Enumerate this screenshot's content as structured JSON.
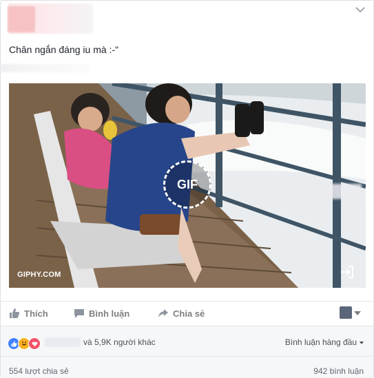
{
  "post": {
    "text": "Chân ngắn đáng iu mà :-\""
  },
  "media": {
    "gif_label": "GIF",
    "source_label": "GIPHY.COM"
  },
  "actions": {
    "like": "Thích",
    "comment": "Bình luận",
    "share": "Chia sẻ"
  },
  "footer": {
    "reactions_others": "và 5,9K người khác",
    "sort_label": "Bình luận hàng đầu",
    "shares_count": "554 lượt chia sẻ",
    "comments_count": "942 bình luận"
  },
  "colors": {
    "like_reaction": "#4080ff",
    "haha_reaction": "#f7b125",
    "love_reaction": "#f25268"
  }
}
